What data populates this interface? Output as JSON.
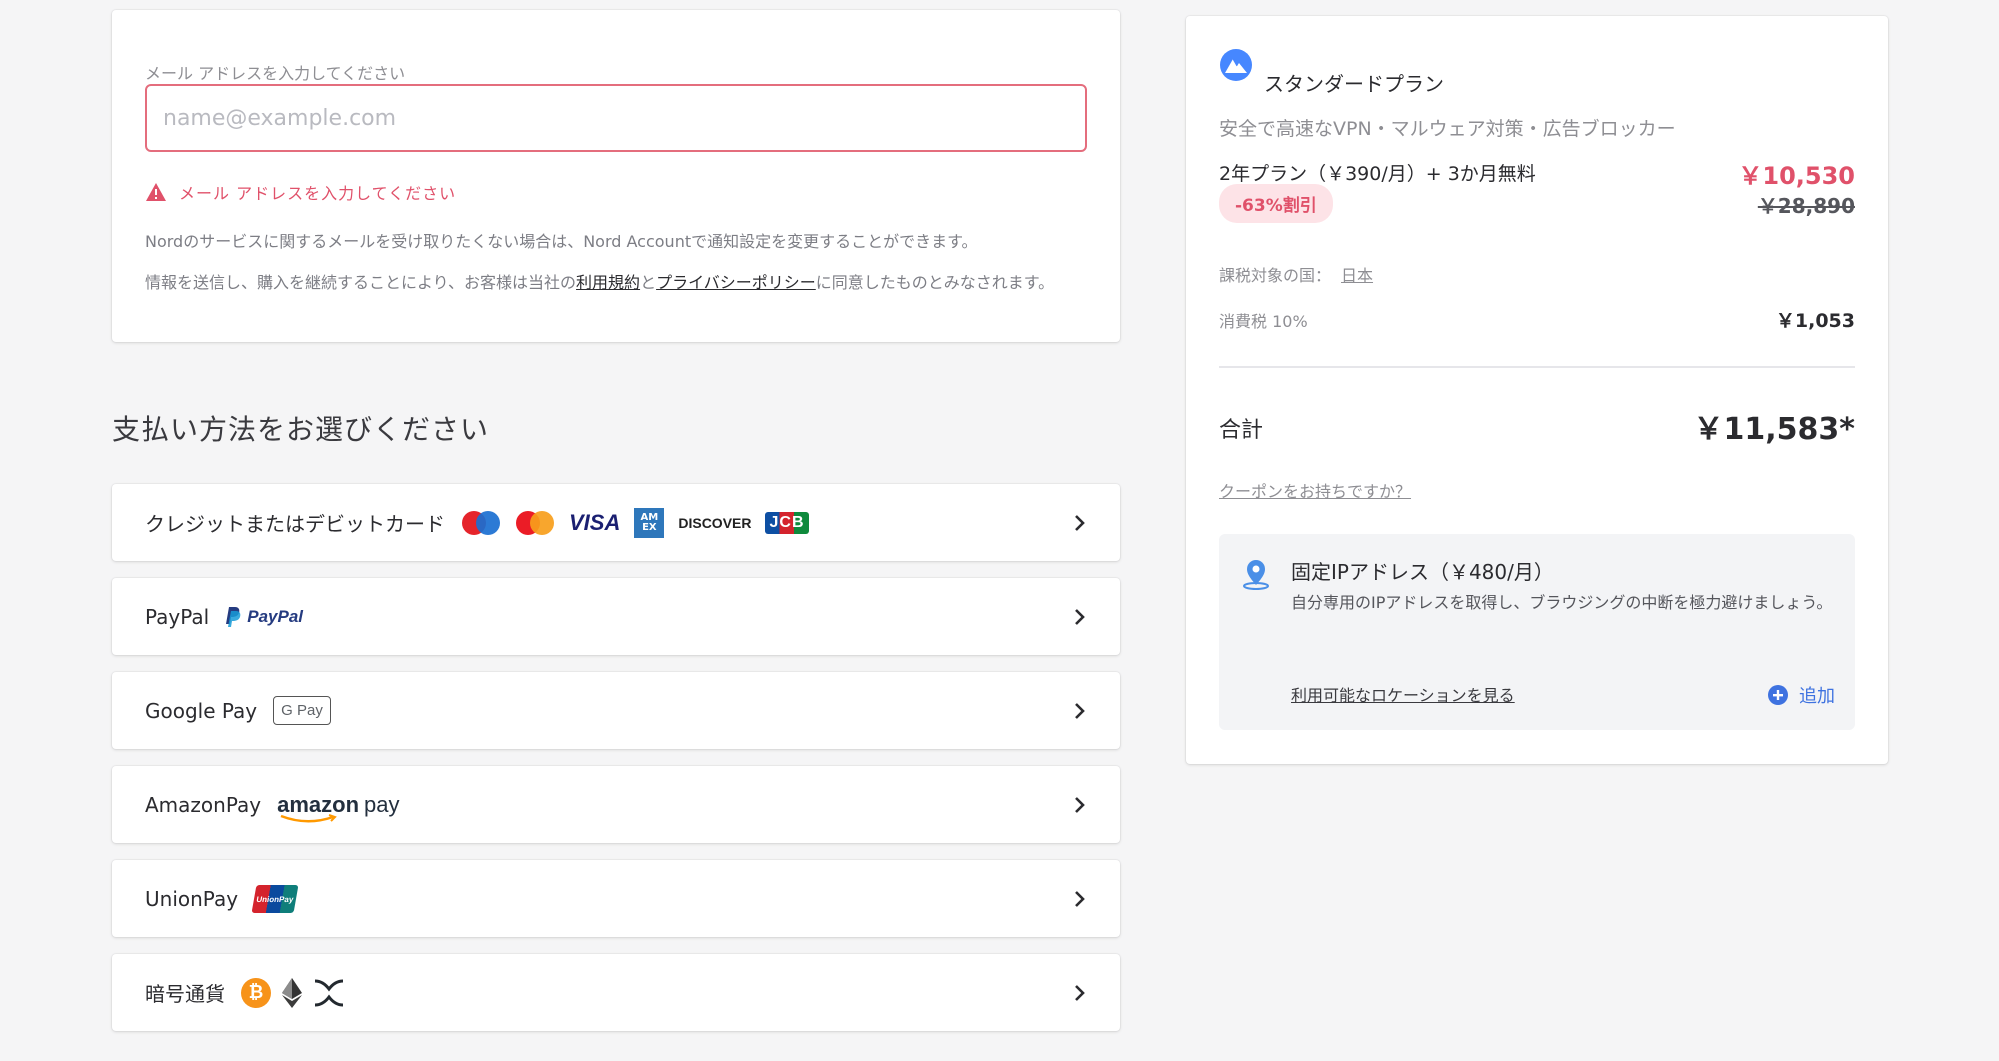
{
  "email": {
    "label": "メール アドレスを入力してください",
    "placeholder": "name@example.com",
    "value": "",
    "error": "メール アドレスを入力してください",
    "notice": "Nordのサービスに関するメールを受け取りたくない場合は、Nord Accountで通知設定を変更することができます。",
    "terms_prefix": "情報を送信し、購入を継続することにより、お客様は当社の",
    "terms_link": "利用規約",
    "terms_and": "と",
    "privacy_link": "プライバシーポリシー",
    "terms_suffix": "に同意したものとみなされます。"
  },
  "payment": {
    "heading": "支払い方法をお選びください",
    "methods": [
      {
        "label": "クレジットまたはデビットカード",
        "logos": [
          "maestro-logo",
          "mastercard-logo",
          "visa-logo",
          "amex-logo",
          "discover-logo",
          "jcb-logo"
        ]
      },
      {
        "label": "PayPal",
        "logos": [
          "paypal-logo"
        ]
      },
      {
        "label": "Google Pay",
        "logos": [
          "google-pay-logo"
        ]
      },
      {
        "label": "AmazonPay",
        "logos": [
          "amazon-pay-logo"
        ]
      },
      {
        "label": "UnionPay",
        "logos": [
          "unionpay-logo"
        ]
      },
      {
        "label": "暗号通貨",
        "logos": [
          "bitcoin-logo",
          "ethereum-logo",
          "xrp-logo"
        ]
      }
    ],
    "logo_text": {
      "visa": "VISA",
      "discover": "DISCOVER",
      "jcb": "JCB",
      "paypal": "PayPal",
      "gpay": "G Pay",
      "amazon": "amazon",
      "pay": "pay",
      "unionpay": "UnionPay",
      "amex": "AM EX",
      "bitcoin": "₿"
    }
  },
  "summary": {
    "plan_name": "スタンダードプラン",
    "plan_desc": "安全で高速なVPN・マルウェア対策・広告ブロッカー",
    "term_label": "2年プラン（￥390/月）+ 3か月無料",
    "term_price": "￥10,530",
    "discount": "-63%割引",
    "old_price": "￥28,890",
    "tax_country_label": "課税対象の国：",
    "tax_country": "日本",
    "vat_label": "消費税 10%",
    "vat_amount": "￥1,053",
    "total_label": "合計",
    "total_amount": "￥11,583*",
    "coupon": "クーポンをお持ちですか？",
    "ip_title": "固定IPアドレス（￥480/月）",
    "ip_desc": "自分専用のIPアドレスを取得し、ブラウジングの中断を極力避けましょう。",
    "ip_link": "利用可能なロケーションを見る",
    "ip_add": "追加"
  },
  "colors": {
    "accent": "#3e72e0",
    "error": "#e0516a",
    "page_bg": "#f5f5f6"
  }
}
